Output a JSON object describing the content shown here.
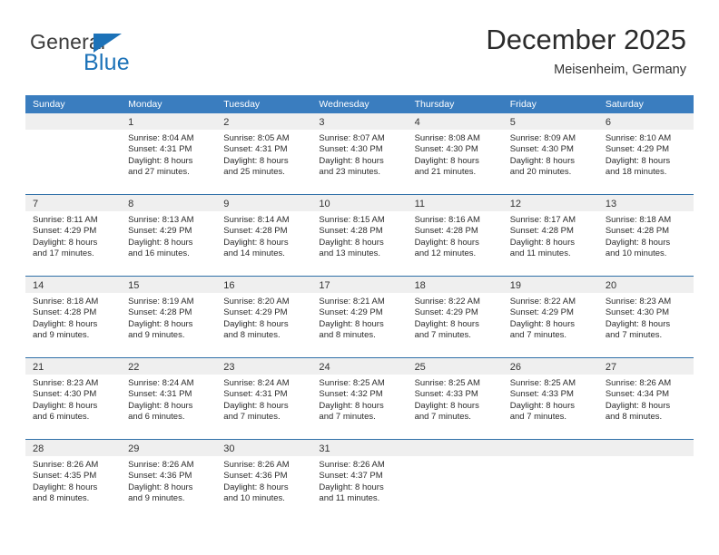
{
  "brand": {
    "name_top": "General",
    "name_bottom": "Blue",
    "triangle_color": "#1c72b8"
  },
  "header": {
    "title": "December 2025",
    "subtitle": "Meisenheim, Germany"
  },
  "colors": {
    "header_row": "#3a7dbf",
    "row_divider": "#2f6fa8",
    "daynum_strip": "#efefef",
    "brand_blue": "#1c72b8"
  },
  "weekday_headers": [
    "Sunday",
    "Monday",
    "Tuesday",
    "Wednesday",
    "Thursday",
    "Friday",
    "Saturday"
  ],
  "weeks": [
    [
      {
        "day": "",
        "sunrise": "",
        "sunset": "",
        "daylight1": "",
        "daylight2": "",
        "empty": true
      },
      {
        "day": "1",
        "sunrise": "Sunrise: 8:04 AM",
        "sunset": "Sunset: 4:31 PM",
        "daylight1": "Daylight: 8 hours",
        "daylight2": "and 27 minutes.",
        "empty": false
      },
      {
        "day": "2",
        "sunrise": "Sunrise: 8:05 AM",
        "sunset": "Sunset: 4:31 PM",
        "daylight1": "Daylight: 8 hours",
        "daylight2": "and 25 minutes.",
        "empty": false
      },
      {
        "day": "3",
        "sunrise": "Sunrise: 8:07 AM",
        "sunset": "Sunset: 4:30 PM",
        "daylight1": "Daylight: 8 hours",
        "daylight2": "and 23 minutes.",
        "empty": false
      },
      {
        "day": "4",
        "sunrise": "Sunrise: 8:08 AM",
        "sunset": "Sunset: 4:30 PM",
        "daylight1": "Daylight: 8 hours",
        "daylight2": "and 21 minutes.",
        "empty": false
      },
      {
        "day": "5",
        "sunrise": "Sunrise: 8:09 AM",
        "sunset": "Sunset: 4:30 PM",
        "daylight1": "Daylight: 8 hours",
        "daylight2": "and 20 minutes.",
        "empty": false
      },
      {
        "day": "6",
        "sunrise": "Sunrise: 8:10 AM",
        "sunset": "Sunset: 4:29 PM",
        "daylight1": "Daylight: 8 hours",
        "daylight2": "and 18 minutes.",
        "empty": false
      }
    ],
    [
      {
        "day": "7",
        "sunrise": "Sunrise: 8:11 AM",
        "sunset": "Sunset: 4:29 PM",
        "daylight1": "Daylight: 8 hours",
        "daylight2": "and 17 minutes.",
        "empty": false
      },
      {
        "day": "8",
        "sunrise": "Sunrise: 8:13 AM",
        "sunset": "Sunset: 4:29 PM",
        "daylight1": "Daylight: 8 hours",
        "daylight2": "and 16 minutes.",
        "empty": false
      },
      {
        "day": "9",
        "sunrise": "Sunrise: 8:14 AM",
        "sunset": "Sunset: 4:28 PM",
        "daylight1": "Daylight: 8 hours",
        "daylight2": "and 14 minutes.",
        "empty": false
      },
      {
        "day": "10",
        "sunrise": "Sunrise: 8:15 AM",
        "sunset": "Sunset: 4:28 PM",
        "daylight1": "Daylight: 8 hours",
        "daylight2": "and 13 minutes.",
        "empty": false
      },
      {
        "day": "11",
        "sunrise": "Sunrise: 8:16 AM",
        "sunset": "Sunset: 4:28 PM",
        "daylight1": "Daylight: 8 hours",
        "daylight2": "and 12 minutes.",
        "empty": false
      },
      {
        "day": "12",
        "sunrise": "Sunrise: 8:17 AM",
        "sunset": "Sunset: 4:28 PM",
        "daylight1": "Daylight: 8 hours",
        "daylight2": "and 11 minutes.",
        "empty": false
      },
      {
        "day": "13",
        "sunrise": "Sunrise: 8:18 AM",
        "sunset": "Sunset: 4:28 PM",
        "daylight1": "Daylight: 8 hours",
        "daylight2": "and 10 minutes.",
        "empty": false
      }
    ],
    [
      {
        "day": "14",
        "sunrise": "Sunrise: 8:18 AM",
        "sunset": "Sunset: 4:28 PM",
        "daylight1": "Daylight: 8 hours",
        "daylight2": "and 9 minutes.",
        "empty": false
      },
      {
        "day": "15",
        "sunrise": "Sunrise: 8:19 AM",
        "sunset": "Sunset: 4:28 PM",
        "daylight1": "Daylight: 8 hours",
        "daylight2": "and 9 minutes.",
        "empty": false
      },
      {
        "day": "16",
        "sunrise": "Sunrise: 8:20 AM",
        "sunset": "Sunset: 4:29 PM",
        "daylight1": "Daylight: 8 hours",
        "daylight2": "and 8 minutes.",
        "empty": false
      },
      {
        "day": "17",
        "sunrise": "Sunrise: 8:21 AM",
        "sunset": "Sunset: 4:29 PM",
        "daylight1": "Daylight: 8 hours",
        "daylight2": "and 8 minutes.",
        "empty": false
      },
      {
        "day": "18",
        "sunrise": "Sunrise: 8:22 AM",
        "sunset": "Sunset: 4:29 PM",
        "daylight1": "Daylight: 8 hours",
        "daylight2": "and 7 minutes.",
        "empty": false
      },
      {
        "day": "19",
        "sunrise": "Sunrise: 8:22 AM",
        "sunset": "Sunset: 4:29 PM",
        "daylight1": "Daylight: 8 hours",
        "daylight2": "and 7 minutes.",
        "empty": false
      },
      {
        "day": "20",
        "sunrise": "Sunrise: 8:23 AM",
        "sunset": "Sunset: 4:30 PM",
        "daylight1": "Daylight: 8 hours",
        "daylight2": "and 7 minutes.",
        "empty": false
      }
    ],
    [
      {
        "day": "21",
        "sunrise": "Sunrise: 8:23 AM",
        "sunset": "Sunset: 4:30 PM",
        "daylight1": "Daylight: 8 hours",
        "daylight2": "and 6 minutes.",
        "empty": false
      },
      {
        "day": "22",
        "sunrise": "Sunrise: 8:24 AM",
        "sunset": "Sunset: 4:31 PM",
        "daylight1": "Daylight: 8 hours",
        "daylight2": "and 6 minutes.",
        "empty": false
      },
      {
        "day": "23",
        "sunrise": "Sunrise: 8:24 AM",
        "sunset": "Sunset: 4:31 PM",
        "daylight1": "Daylight: 8 hours",
        "daylight2": "and 7 minutes.",
        "empty": false
      },
      {
        "day": "24",
        "sunrise": "Sunrise: 8:25 AM",
        "sunset": "Sunset: 4:32 PM",
        "daylight1": "Daylight: 8 hours",
        "daylight2": "and 7 minutes.",
        "empty": false
      },
      {
        "day": "25",
        "sunrise": "Sunrise: 8:25 AM",
        "sunset": "Sunset: 4:33 PM",
        "daylight1": "Daylight: 8 hours",
        "daylight2": "and 7 minutes.",
        "empty": false
      },
      {
        "day": "26",
        "sunrise": "Sunrise: 8:25 AM",
        "sunset": "Sunset: 4:33 PM",
        "daylight1": "Daylight: 8 hours",
        "daylight2": "and 7 minutes.",
        "empty": false
      },
      {
        "day": "27",
        "sunrise": "Sunrise: 8:26 AM",
        "sunset": "Sunset: 4:34 PM",
        "daylight1": "Daylight: 8 hours",
        "daylight2": "and 8 minutes.",
        "empty": false
      }
    ],
    [
      {
        "day": "28",
        "sunrise": "Sunrise: 8:26 AM",
        "sunset": "Sunset: 4:35 PM",
        "daylight1": "Daylight: 8 hours",
        "daylight2": "and 8 minutes.",
        "empty": false
      },
      {
        "day": "29",
        "sunrise": "Sunrise: 8:26 AM",
        "sunset": "Sunset: 4:36 PM",
        "daylight1": "Daylight: 8 hours",
        "daylight2": "and 9 minutes.",
        "empty": false
      },
      {
        "day": "30",
        "sunrise": "Sunrise: 8:26 AM",
        "sunset": "Sunset: 4:36 PM",
        "daylight1": "Daylight: 8 hours",
        "daylight2": "and 10 minutes.",
        "empty": false
      },
      {
        "day": "31",
        "sunrise": "Sunrise: 8:26 AM",
        "sunset": "Sunset: 4:37 PM",
        "daylight1": "Daylight: 8 hours",
        "daylight2": "and 11 minutes.",
        "empty": false
      },
      {
        "day": "",
        "sunrise": "",
        "sunset": "",
        "daylight1": "",
        "daylight2": "",
        "empty": true
      },
      {
        "day": "",
        "sunrise": "",
        "sunset": "",
        "daylight1": "",
        "daylight2": "",
        "empty": true
      },
      {
        "day": "",
        "sunrise": "",
        "sunset": "",
        "daylight1": "",
        "daylight2": "",
        "empty": true
      }
    ]
  ]
}
